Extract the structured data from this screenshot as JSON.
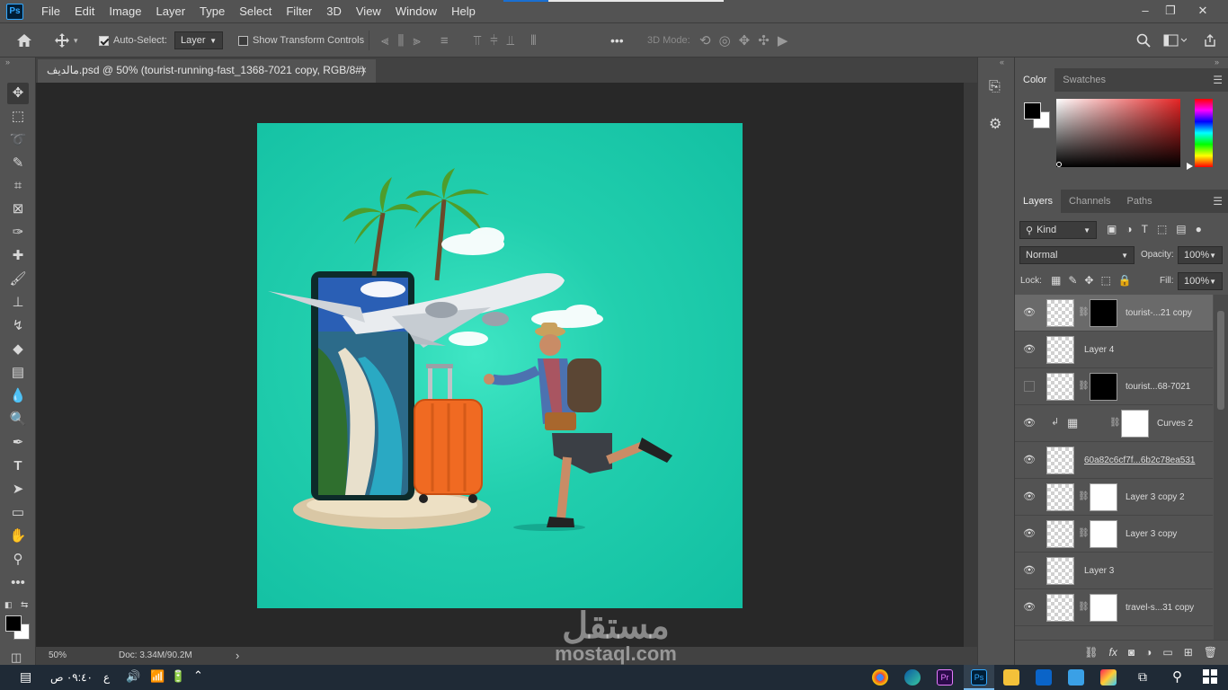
{
  "app": {
    "logo": "Ps",
    "doc_tab_title": "مالديف.psd @ 50% (tourist-running-fast_1368-7021 copy, RGB/8#)",
    "doc_tab_close": "×"
  },
  "menu": [
    "File",
    "Edit",
    "Image",
    "Layer",
    "Type",
    "Select",
    "Filter",
    "3D",
    "View",
    "Window",
    "Help"
  ],
  "window_controls": {
    "minimize": "–",
    "restore": "❐",
    "close": "✕"
  },
  "options_bar": {
    "auto_select_label": "Auto-Select:",
    "auto_select_checked": true,
    "auto_select_target": "Layer",
    "show_transform_label": "Show Transform Controls",
    "show_transform_checked": false,
    "more": "•••",
    "mode_3d": "3D Mode:"
  },
  "status": {
    "zoom": "50%",
    "doc": "Doc: 3.34M/90.2M",
    "arrow": "›"
  },
  "color_panel": {
    "tabs": [
      "Color",
      "Swatches"
    ],
    "foreground": "#000000",
    "background": "#ffffff",
    "hue_picker": "#e52525"
  },
  "layers_panel": {
    "tabs": [
      "Layers",
      "Channels",
      "Paths"
    ],
    "filter_kind": "Kind",
    "blend_mode": "Normal",
    "opacity_label": "Opacity:",
    "opacity": "100%",
    "lock_label": "Lock:",
    "fill_label": "Fill:",
    "fill": "100%",
    "layers": [
      {
        "name": "tourist-...21 copy",
        "visible": true,
        "selected": true,
        "has_mask": true,
        "mask": "black"
      },
      {
        "name": "Layer 4",
        "visible": true,
        "selected": false,
        "has_mask": false
      },
      {
        "name": "tourist...68-7021",
        "visible": false,
        "selected": false,
        "has_mask": true,
        "mask": "black"
      },
      {
        "name": "Curves 2",
        "visible": true,
        "selected": false,
        "has_mask": true,
        "mask": "white",
        "adjustment": true
      },
      {
        "name": "60a82c6cf7f...6b2c78ea531",
        "visible": true,
        "selected": false,
        "has_mask": false,
        "underlined": true
      },
      {
        "name": "Layer 3 copy 2",
        "visible": true,
        "selected": false,
        "has_mask": true,
        "mask": "white"
      },
      {
        "name": "Layer 3 copy",
        "visible": true,
        "selected": false,
        "has_mask": true,
        "mask": "white"
      },
      {
        "name": "Layer 3",
        "visible": true,
        "selected": false,
        "has_mask": false
      },
      {
        "name": "travel-s...31 copy",
        "visible": true,
        "selected": false,
        "has_mask": true,
        "mask": "white"
      }
    ],
    "footer_icons": [
      "link-icon",
      "fx-icon",
      "mask-icon",
      "adjustment-icon",
      "group-icon",
      "new-layer-icon",
      "trash-icon"
    ]
  },
  "taskbar": {
    "time": "٠٩:٤٠ ص",
    "lang": "ع"
  },
  "watermark": {
    "arabic": "مستقل",
    "latin": "mostaql.com"
  },
  "canvas": {
    "background": "#1fcaa9",
    "suitcase_color": "#f06a22"
  }
}
